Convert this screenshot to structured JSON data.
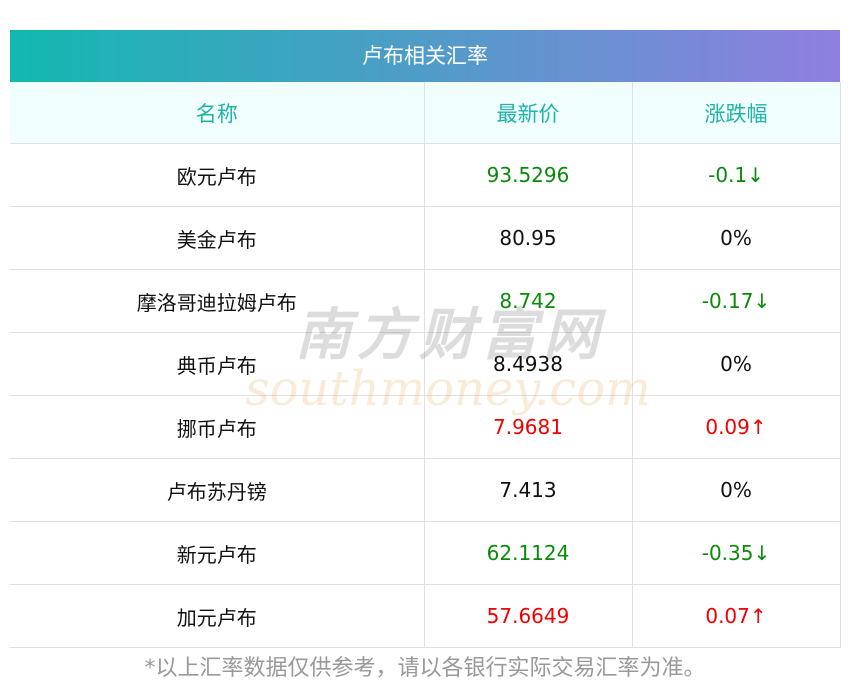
{
  "title": "卢布相关汇率",
  "headers": [
    "名称",
    "最新价",
    "涨跌幅"
  ],
  "rows": [
    {
      "name": "欧元卢布",
      "price": "93.5296",
      "change": "-0.1↓",
      "trend": "down"
    },
    {
      "name": "美金卢布",
      "price": "80.95",
      "change": "0%",
      "trend": "flat"
    },
    {
      "name": "摩洛哥迪拉姆卢布",
      "price": "8.742",
      "change": "-0.17↓",
      "trend": "down"
    },
    {
      "name": "典币卢布",
      "price": "8.4938",
      "change": "0%",
      "trend": "flat"
    },
    {
      "name": "挪币卢布",
      "price": "7.9681",
      "change": "0.09↑",
      "trend": "up"
    },
    {
      "name": "卢布苏丹镑",
      "price": "7.413",
      "change": "0%",
      "trend": "flat"
    },
    {
      "name": "新元卢布",
      "price": "62.1124",
      "change": "-0.35↓",
      "trend": "down"
    },
    {
      "name": "加元卢布",
      "price": "57.6649",
      "change": "0.07↑",
      "trend": "up"
    }
  ],
  "note": "*以上汇率数据仅供参考，请以各银行实际交易汇率为准。",
  "watermark": {
    "cn": "南方财富网",
    "en": "southmoney.com"
  },
  "colors": {
    "up": "#f00000",
    "down": "#0a8a0a",
    "flat": "#111111"
  }
}
